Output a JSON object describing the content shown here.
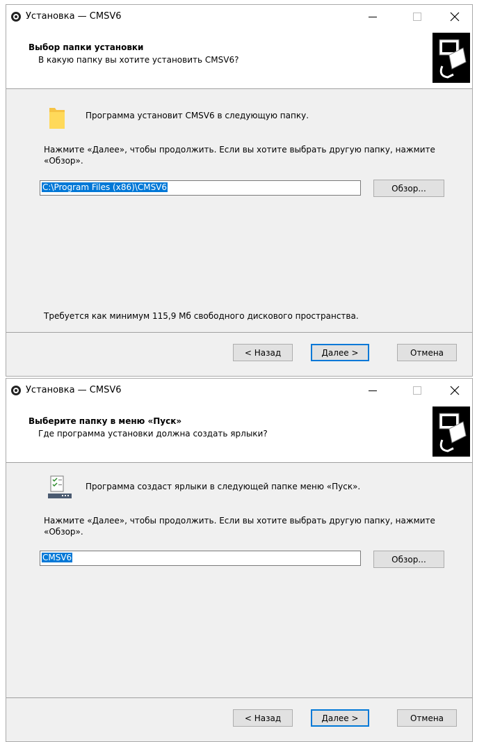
{
  "windows": [
    {
      "title": "Установка — CMSV6",
      "header_title": "Выбор папки установки",
      "header_subtitle": "В какую папку вы хотите установить CMSV6?",
      "page_label": "Программа установит CMSV6 в следующую папку.",
      "hint": "Нажмите «Далее», чтобы продолжить. Если вы хотите выбрать другую папку, нажмите «Обзор».",
      "path_value": "C:\\Program Files (x86)\\CMSV6",
      "browse_label": "Обзор...",
      "space_text": "Требуется как минимум 115,9 Мб свободного дискового пространства.",
      "back_label": "< Назад",
      "next_label": "Далее >",
      "cancel_label": "Отмена",
      "icon": "folder-icon"
    },
    {
      "title": "Установка — CMSV6",
      "header_title": "Выберите папку в меню «Пуск»",
      "header_subtitle": "Где программа установки должна создать ярлыки?",
      "page_label": "Программа создаст ярлыки в следующей папке меню «Пуск».",
      "hint": "Нажмите «Далее», чтобы продолжить. Если вы хотите выбрать другую папку, нажмите «Обзор».",
      "path_value": "CMSV6",
      "browse_label": "Обзор...",
      "back_label": "< Назад",
      "next_label": "Далее >",
      "cancel_label": "Отмена",
      "icon": "start-menu-folder-icon"
    }
  ],
  "colors": {
    "accent": "#0078d7",
    "button": "#e1e1e1",
    "dialog_bg": "#f0f0f0"
  }
}
